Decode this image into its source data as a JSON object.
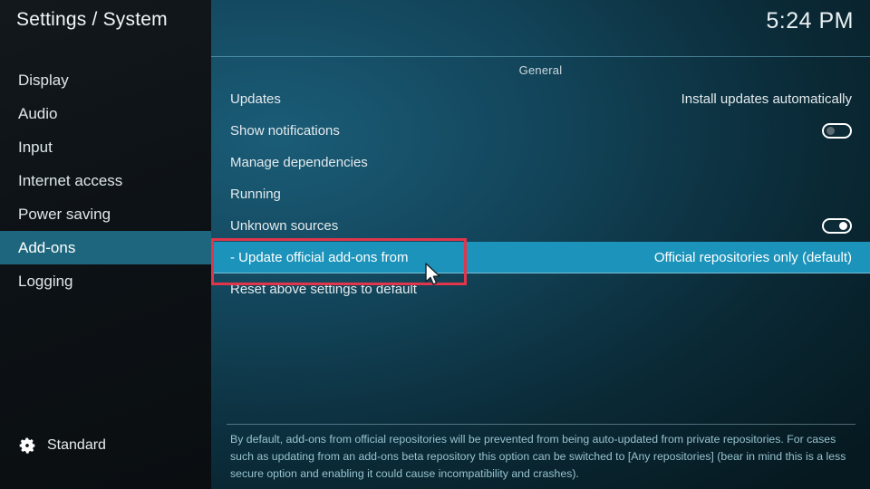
{
  "header": {
    "title": "Settings / System",
    "clock": "5:24 PM"
  },
  "sidebar": {
    "items": [
      {
        "label": "Display",
        "selected": false
      },
      {
        "label": "Audio",
        "selected": false
      },
      {
        "label": "Input",
        "selected": false
      },
      {
        "label": "Internet access",
        "selected": false
      },
      {
        "label": "Power saving",
        "selected": false
      },
      {
        "label": "Add-ons",
        "selected": true
      },
      {
        "label": "Logging",
        "selected": false
      }
    ],
    "profile": {
      "icon": "gear-icon",
      "label": "Standard"
    }
  },
  "main": {
    "group_title": "General",
    "rows": [
      {
        "label": "Updates",
        "value": "Install updates automatically",
        "control": "text",
        "selected": false
      },
      {
        "label": "Show notifications",
        "value": "",
        "control": "toggle",
        "toggle_state": "off",
        "selected": false
      },
      {
        "label": "Manage dependencies",
        "value": "",
        "control": "none",
        "selected": false
      },
      {
        "label": "Running",
        "value": "",
        "control": "none",
        "selected": false
      },
      {
        "label": "Unknown sources",
        "value": "",
        "control": "toggle",
        "toggle_state": "on",
        "selected": false
      },
      {
        "label": "- Update official add-ons from",
        "value": "Official repositories only (default)",
        "control": "text",
        "selected": true
      },
      {
        "label": "Reset above settings to default",
        "value": "",
        "control": "none",
        "selected": false
      }
    ],
    "help_text": "By default, add-ons from official repositories will be prevented from being auto-updated from private repositories. For cases such as updating from an add-ons beta repository this option can be switched to [Any repositories] (bear in mind this is a less secure option and enabling it could cause incompatibility and crashes)."
  },
  "annotation": {
    "highlight_color": "#e0354a",
    "cursor": "mouse-pointer"
  },
  "colors": {
    "selection_row": "#1c93bb",
    "sidebar_selection": "#1d667d",
    "help_text": "#97c3cf"
  }
}
